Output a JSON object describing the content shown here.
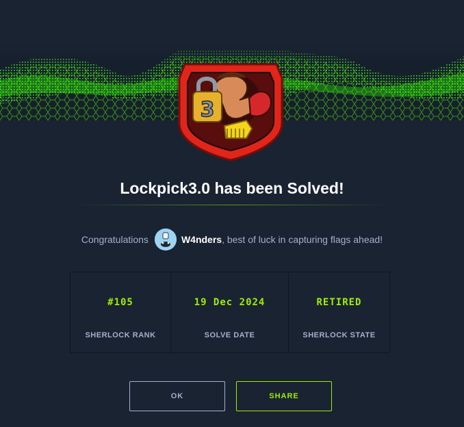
{
  "title": "Lockpick3.0 has been Solved!",
  "congrats": {
    "prefix": "Congratulations",
    "username": "W4nders",
    "suffix": ", best of luck in capturing flags ahead!"
  },
  "badge": {
    "number": "3"
  },
  "stats": [
    {
      "value": "#105",
      "label": "SHERLOCK RANK"
    },
    {
      "value": "19 Dec 2024",
      "label": "SOLVE DATE"
    },
    {
      "value": "RETIRED",
      "label": "SHERLOCK STATE"
    }
  ],
  "buttons": {
    "ok": "OK",
    "share": "SHARE"
  },
  "colors": {
    "background": "#1a2332",
    "accent": "#9fef00",
    "muted": "#a4b1cd",
    "badge_red": "#e0251b"
  },
  "icons": {
    "banner": "green-mesh-wave",
    "badge": "lock-shield-badge",
    "avatar": "user-avatar"
  }
}
